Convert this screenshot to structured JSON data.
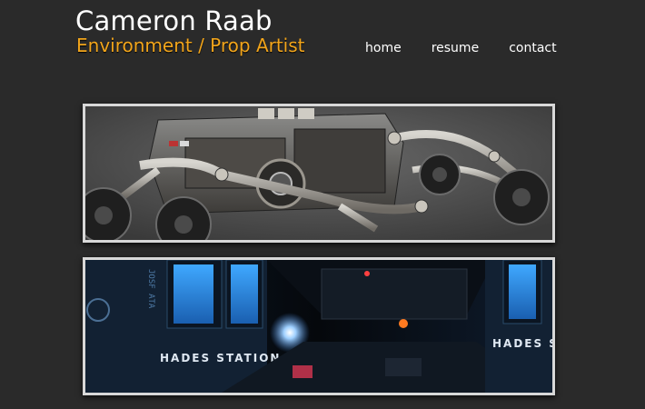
{
  "header": {
    "name": "Cameron Raab",
    "role": "Environment / Prop Artist"
  },
  "nav": {
    "home": "home",
    "resume": "resume",
    "contact": "contact"
  },
  "panels": {
    "station_left_sign": "HADES STATION",
    "station_right_sign": "HADES S",
    "station_vertical_text": "JOSF ATA"
  },
  "colors": {
    "background": "#2a2a2a",
    "accent": "#f2a51b",
    "nav_text": "#ffffff"
  }
}
